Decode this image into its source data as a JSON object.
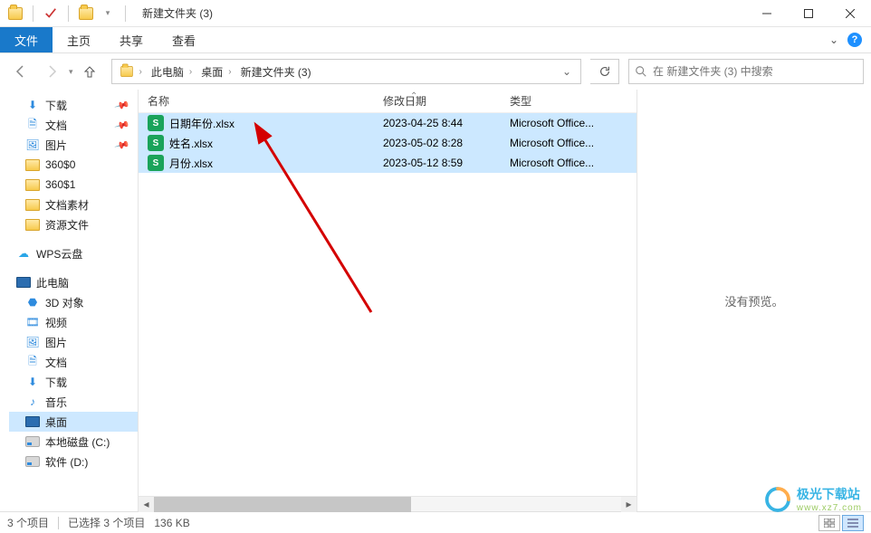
{
  "window": {
    "title": "新建文件夹 (3)"
  },
  "ribbon": {
    "file": "文件",
    "tabs": [
      "主页",
      "共享",
      "查看"
    ]
  },
  "breadcrumb": {
    "segments": [
      "此电脑",
      "桌面",
      "新建文件夹 (3)"
    ]
  },
  "search": {
    "placeholder": "在 新建文件夹 (3) 中搜索"
  },
  "navpane": {
    "quick": [
      {
        "label": "下载",
        "icon": "download",
        "pinned": true
      },
      {
        "label": "文档",
        "icon": "doc",
        "pinned": true
      },
      {
        "label": "图片",
        "icon": "pic",
        "pinned": true
      },
      {
        "label": "360$0",
        "icon": "folder",
        "pinned": false
      },
      {
        "label": "360$1",
        "icon": "folder",
        "pinned": false
      },
      {
        "label": "文档素材",
        "icon": "folder",
        "pinned": false
      },
      {
        "label": "资源文件",
        "icon": "folder",
        "pinned": false
      }
    ],
    "wps": "WPS云盘",
    "thispc": "此电脑",
    "pcitems": [
      {
        "label": "3D 对象",
        "icon": "3d"
      },
      {
        "label": "视频",
        "icon": "video"
      },
      {
        "label": "图片",
        "icon": "pic"
      },
      {
        "label": "文档",
        "icon": "doc"
      },
      {
        "label": "下载",
        "icon": "download"
      },
      {
        "label": "音乐",
        "icon": "music"
      },
      {
        "label": "桌面",
        "icon": "desktop",
        "selected": true
      },
      {
        "label": "本地磁盘 (C:)",
        "icon": "disk"
      },
      {
        "label": "软件 (D:)",
        "icon": "disk"
      }
    ]
  },
  "columns": {
    "name": "名称",
    "date": "修改日期",
    "type": "类型"
  },
  "files": [
    {
      "name": "日期年份.xlsx",
      "date": "2023-04-25 8:44",
      "type": "Microsoft Office..."
    },
    {
      "name": "姓名.xlsx",
      "date": "2023-05-02 8:28",
      "type": "Microsoft Office..."
    },
    {
      "name": "月份.xlsx",
      "date": "2023-05-12 8:59",
      "type": "Microsoft Office..."
    }
  ],
  "preview": {
    "empty": "没有预览。"
  },
  "status": {
    "items": "3 个项目",
    "selected": "已选择 3 个项目",
    "size": "136 KB"
  },
  "watermark": {
    "brand": "极光下载站",
    "url": "www.xz7.com"
  },
  "icons": {
    "xlsx_badge": "S"
  }
}
